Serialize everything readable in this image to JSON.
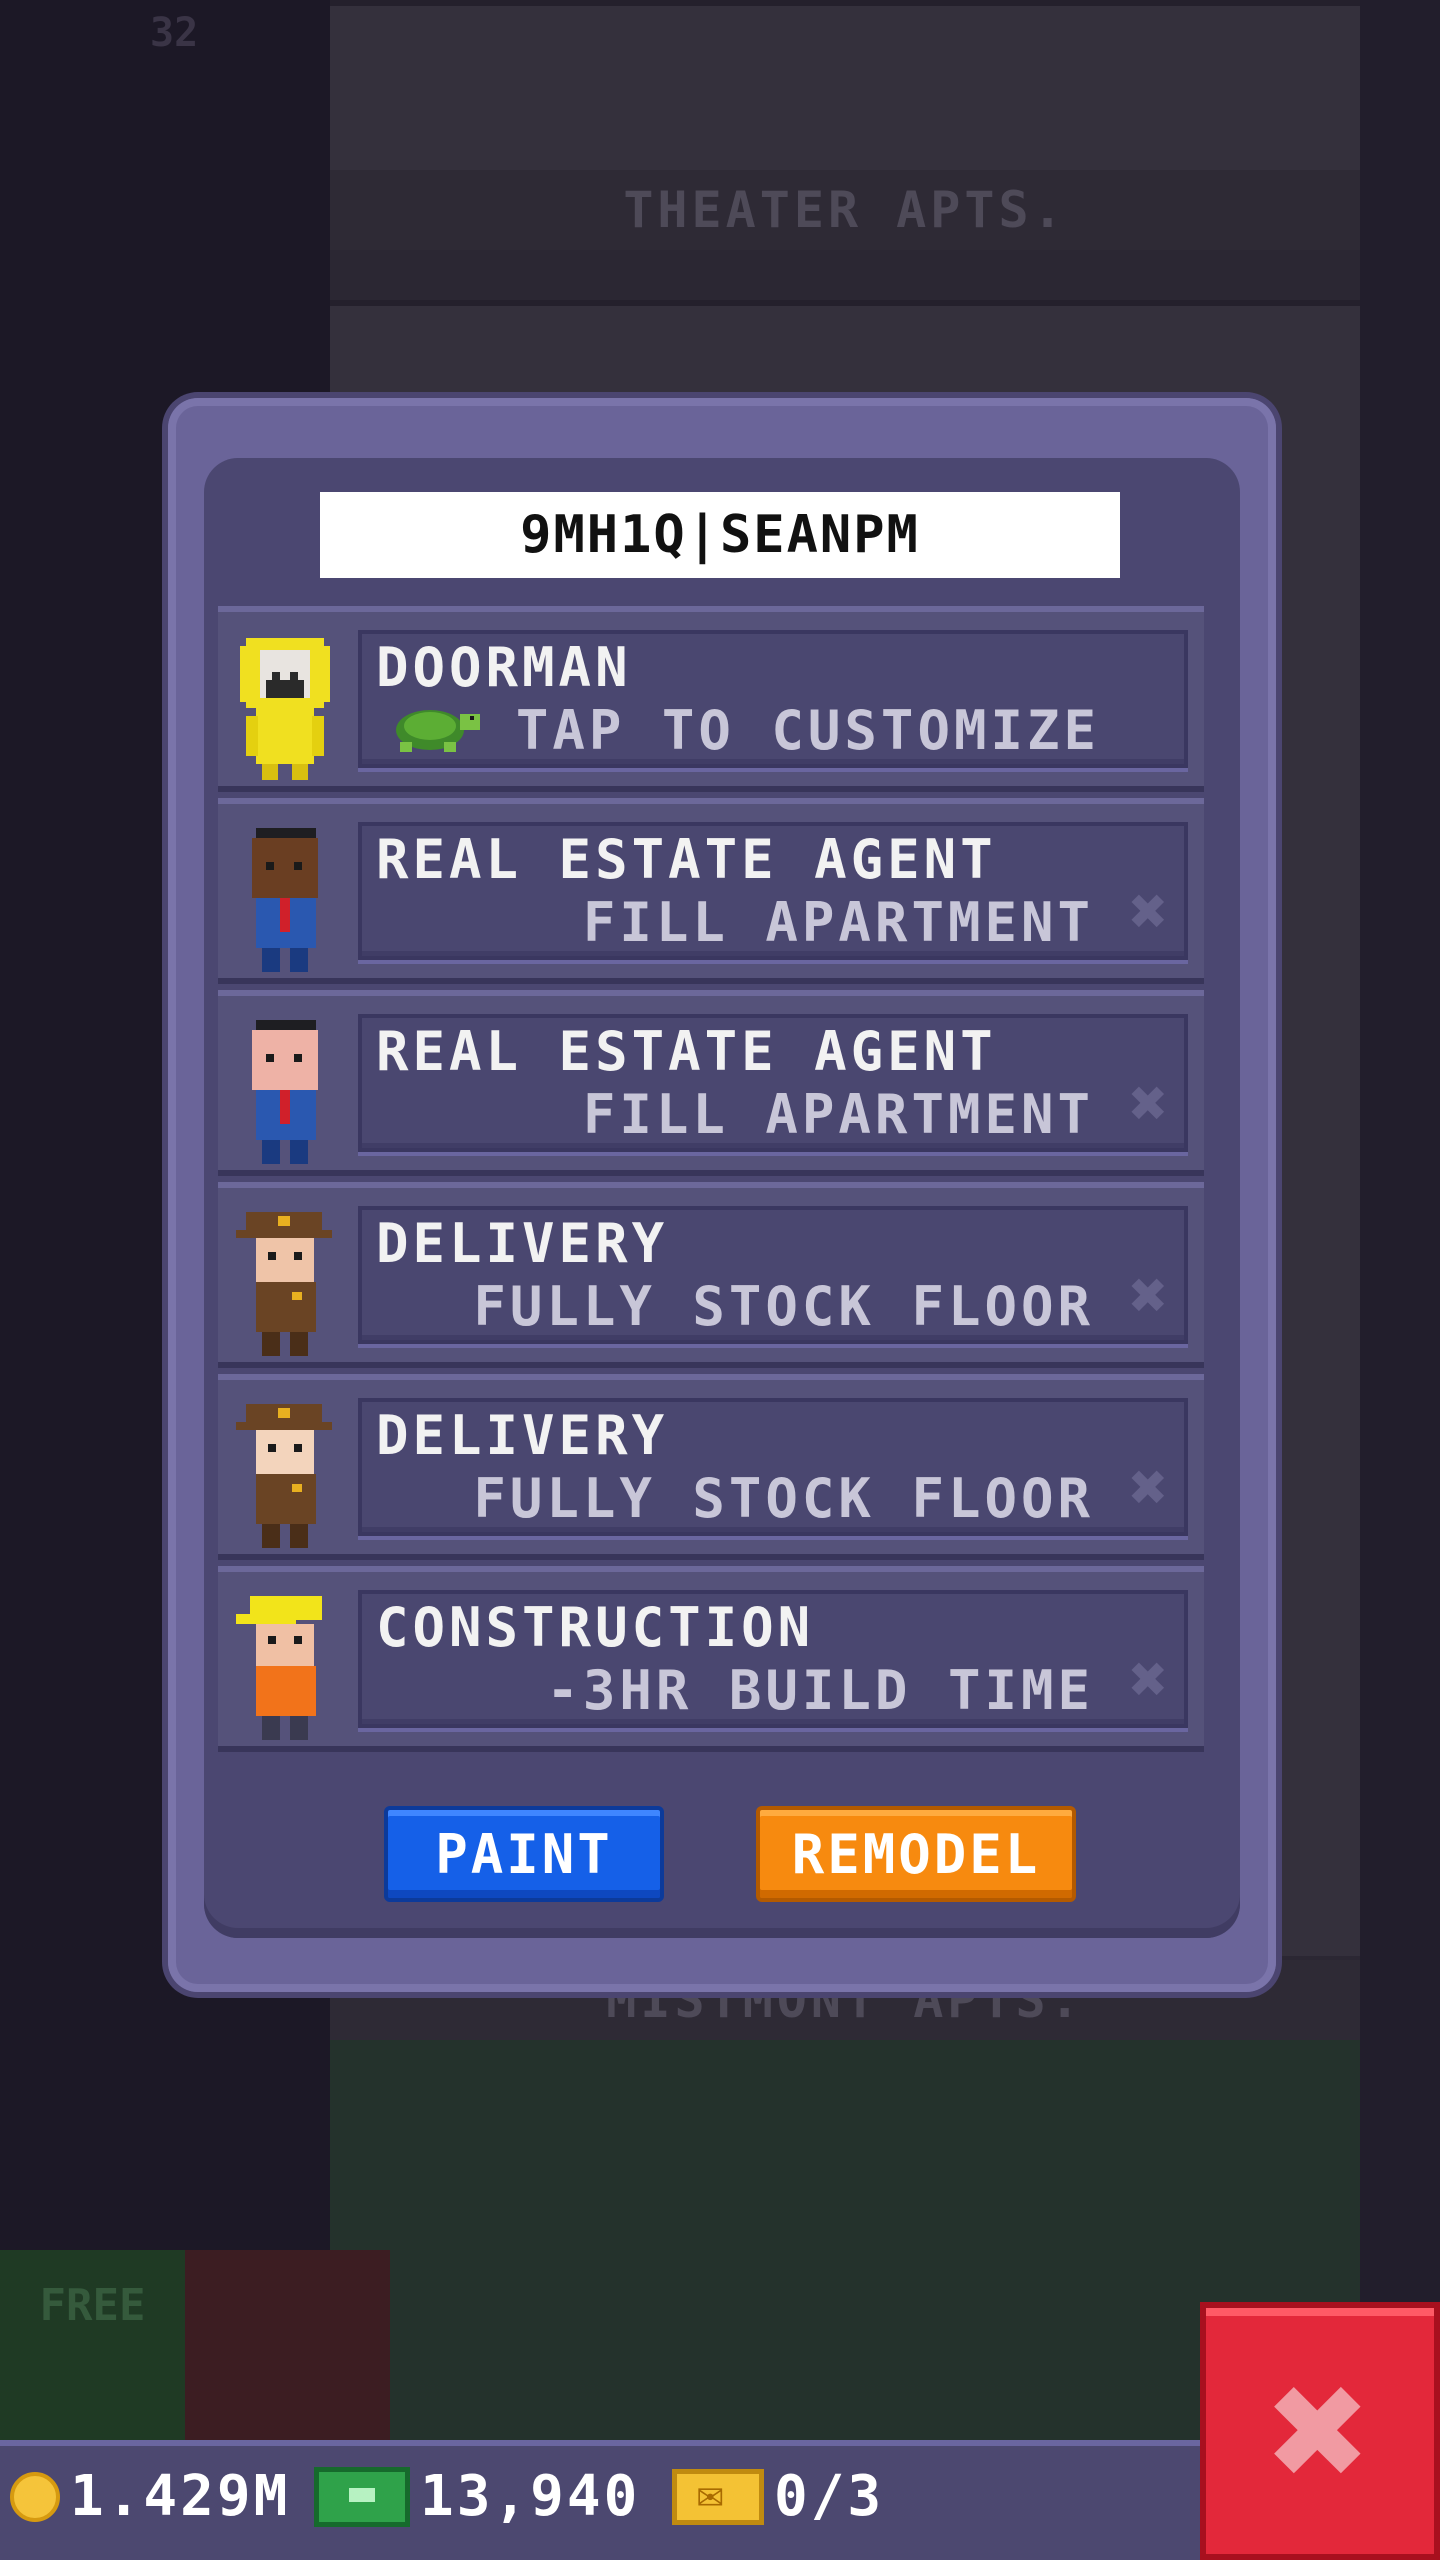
{
  "background": {
    "floor_number": "32",
    "top_floor_label": "THEATER APTS.",
    "bottom_floor_label": "MISTMONT APTS.",
    "free_button_label": "FREE"
  },
  "dialog": {
    "title": "9MH1Q|SEANPM",
    "staff": [
      {
        "role": "DOORMAN",
        "perk": "TAP TO CUSTOMIZE",
        "avatar": "yellow-raincoat-doorman",
        "pet_icon": "turtle-icon"
      },
      {
        "role": "REAL ESTATE AGENT",
        "perk": "FILL APARTMENT",
        "avatar": "agent-dark-skin"
      },
      {
        "role": "REAL ESTATE AGENT",
        "perk": "FILL APARTMENT",
        "avatar": "agent-light-skin"
      },
      {
        "role": "DELIVERY",
        "perk": "FULLY STOCK FLOOR",
        "avatar": "delivery-worker"
      },
      {
        "role": "DELIVERY",
        "perk": "FULLY STOCK FLOOR",
        "avatar": "delivery-worker"
      },
      {
        "role": "CONSTRUCTION",
        "perk": "-3HR BUILD TIME",
        "avatar": "construction-worker"
      }
    ],
    "remove_symbol": "✖",
    "paint_label": "PAINT",
    "remodel_label": "REMODEL"
  },
  "status": {
    "coins": "1.429M",
    "bux": "13,940",
    "tickets": "0/3"
  },
  "close_symbol": "✖",
  "colors": {
    "paint": "#1560e8",
    "remodel": "#f78a0f",
    "close": "#e3283a",
    "panel": "#4b4771"
  }
}
